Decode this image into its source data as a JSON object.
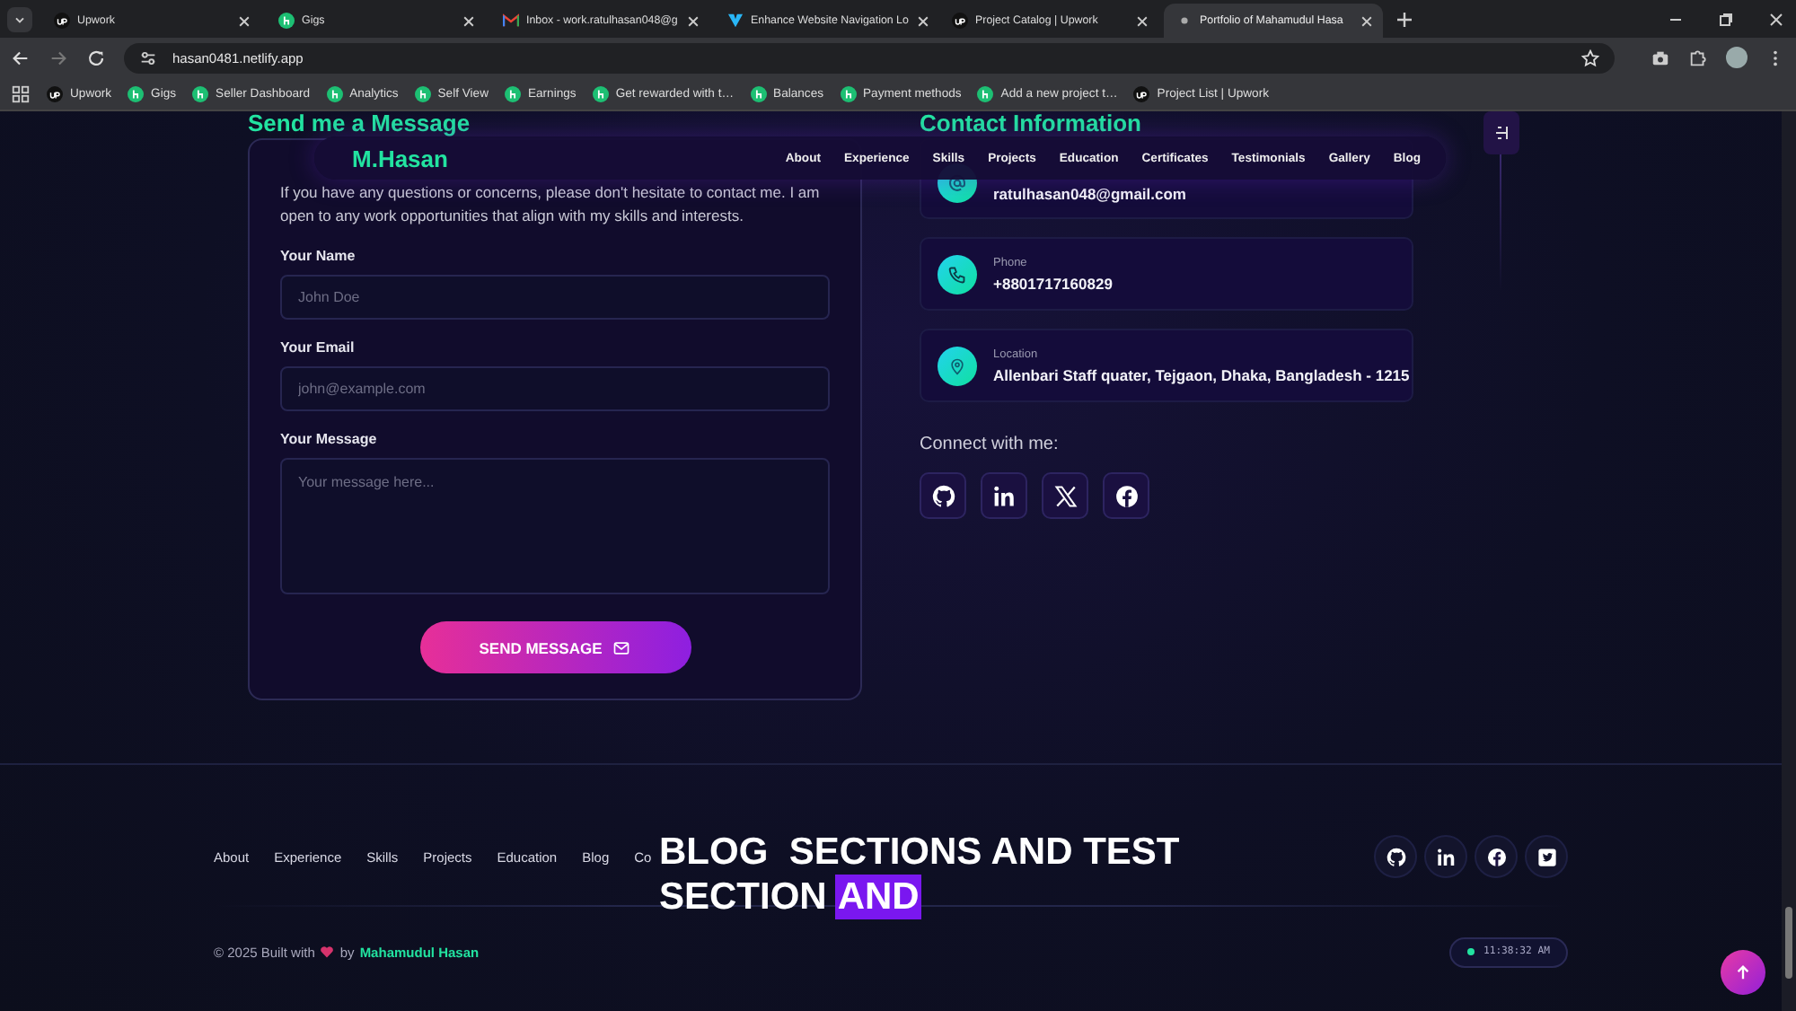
{
  "browser": {
    "tabs": [
      {
        "title": "Upwork",
        "kind": "dark",
        "selected": false
      },
      {
        "title": "Gigs",
        "kind": "green",
        "selected": false
      },
      {
        "title": "Inbox - work.ratulhasan048@g",
        "kind": "mail",
        "selected": false
      },
      {
        "title": "Enhance Website Navigation Lo",
        "kind": "arrow",
        "selected": false
      },
      {
        "title": "Project Catalog | Upwork",
        "kind": "dark",
        "selected": false
      },
      {
        "title": "Portfolio of Mahamudul Hasa",
        "kind": "dot",
        "selected": true
      }
    ],
    "url": "hasan0481.netlify.app",
    "bookmarks": [
      {
        "title": "Upwork",
        "kind": "dark"
      },
      {
        "title": "Gigs",
        "kind": "green"
      },
      {
        "title": "Seller Dashboard",
        "kind": "green"
      },
      {
        "title": "Analytics",
        "kind": "green"
      },
      {
        "title": "Self View",
        "kind": "green"
      },
      {
        "title": "Earnings",
        "kind": "green"
      },
      {
        "title": "Get rewarded with t…",
        "kind": "green"
      },
      {
        "title": "Balances",
        "kind": "green"
      },
      {
        "title": "Payment methods",
        "kind": "green"
      },
      {
        "title": "Add a new project t…",
        "kind": "green"
      },
      {
        "title": "Project List | Upwork",
        "kind": "dark"
      }
    ]
  },
  "navbar": {
    "logo": "M.Hasan",
    "links": [
      "About",
      "Experience",
      "Skills",
      "Projects",
      "Education",
      "Certificates",
      "Testimonials",
      "Gallery",
      "Blog"
    ]
  },
  "contact_form": {
    "heading": "Send me a Message",
    "intro": "If you have any questions or concerns, please don't hesitate to contact me. I am open to any work opportunities that align with my skills and interests.",
    "fields": [
      {
        "label": "Your Name",
        "placeholder": "John Doe",
        "kind": "input"
      },
      {
        "label": "Your Email",
        "placeholder": "john@example.com",
        "kind": "input"
      },
      {
        "label": "Your Message",
        "placeholder": "Your message here...",
        "kind": "textarea"
      }
    ],
    "submit": "SEND MESSAGE"
  },
  "contact_info": {
    "heading": "Contact Information",
    "items": [
      {
        "kind": "email",
        "value": "ratulhasan048@gmail.com"
      },
      {
        "kind": "phone",
        "label": "Phone",
        "value": "+8801717160829"
      },
      {
        "kind": "location",
        "label": "Location",
        "value": "Allenbari Staff quater, Tejgaon, Dhaka, Bangladesh - 1215"
      }
    ],
    "connect_heading": "Connect with me:",
    "socials": [
      {
        "kind": "github"
      },
      {
        "kind": "linkedin"
      },
      {
        "kind": "x"
      },
      {
        "kind": "facebook"
      }
    ]
  },
  "footer": {
    "links": [
      "About",
      "Experience",
      "Skills",
      "Projects",
      "Education",
      "Blog",
      "Co"
    ],
    "socials": [
      {
        "kind": "github"
      },
      {
        "kind": "linkedin"
      },
      {
        "kind": "facebook"
      },
      {
        "kind": "twitter"
      }
    ],
    "copyright": {
      "before": "© 2025 Built with",
      "after": "by",
      "author": "Mahamudul Hasan"
    },
    "clock": "11:38:32 AM"
  },
  "caption": {
    "lines": [
      [
        {
          "text": "BLOG  SECTIONS AND TEST",
          "highlighted": false
        }
      ],
      [
        {
          "text": "SECTION",
          "highlighted": false
        },
        {
          "text": "AND",
          "highlighted": true
        }
      ]
    ]
  }
}
